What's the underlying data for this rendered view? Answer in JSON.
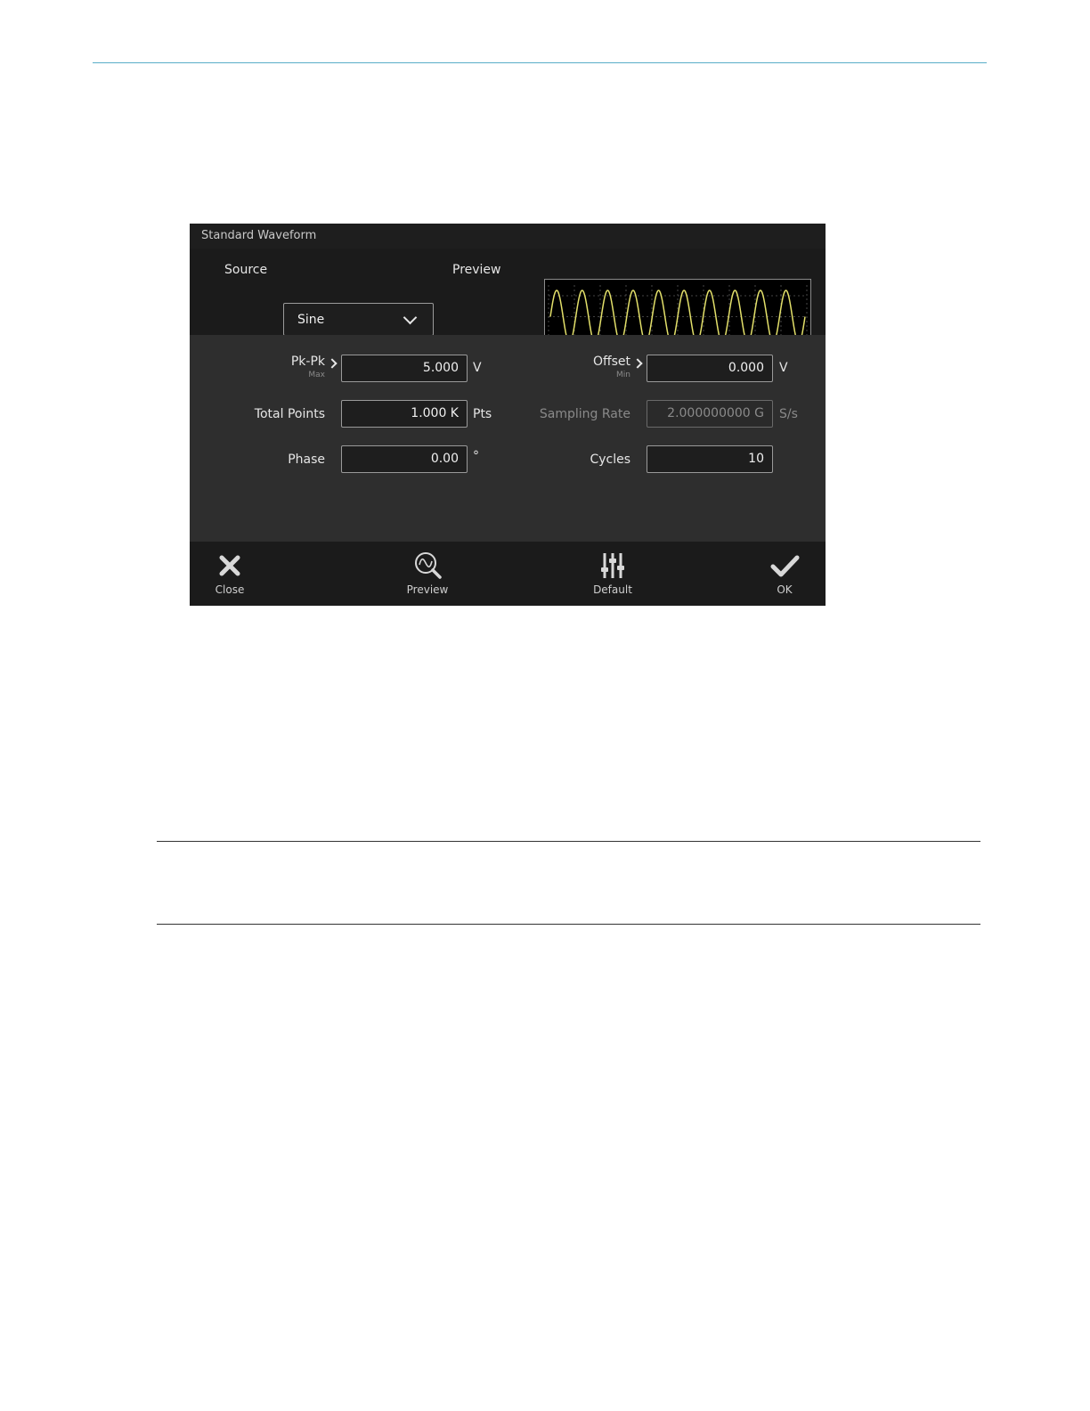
{
  "dialog": {
    "title": "Standard Waveform",
    "source_label": "Source",
    "source_value": "Sine",
    "preview_label": "Preview",
    "preview_cycles": 10
  },
  "fields": {
    "pkpk": {
      "label": "Pk-Pk",
      "sub": "Max",
      "value": "5.000",
      "unit": "V"
    },
    "offset": {
      "label": "Offset",
      "sub": "Min",
      "value": "0.000",
      "unit": "V"
    },
    "total_points": {
      "label": "Total Points",
      "value": "1.000 K",
      "unit": "Pts"
    },
    "sampling_rate": {
      "label": "Sampling Rate",
      "value": "2.000000000 G",
      "unit": "S/s"
    },
    "phase": {
      "label": "Phase",
      "value": "0.00",
      "unit": "°"
    },
    "cycles": {
      "label": "Cycles",
      "value": "10"
    }
  },
  "buttons": {
    "close": "Close",
    "preview": "Preview",
    "default": "Default",
    "ok": "OK"
  },
  "colors": {
    "waveform": "#e3e06a",
    "top_rule": "#5aaec8"
  }
}
